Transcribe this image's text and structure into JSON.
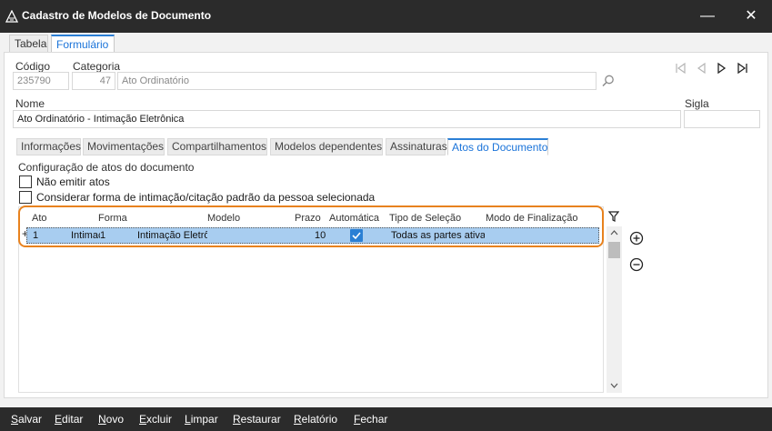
{
  "window": {
    "title": "Cadastro de Modelos de Documento",
    "minimize_glyph": "—",
    "close_glyph": "✕"
  },
  "top_tabs": [
    {
      "label": "Tabela",
      "active": false
    },
    {
      "label": "Formulário",
      "active": true
    }
  ],
  "form": {
    "codigo_label": "Código",
    "codigo_value": "235790",
    "categoria_label": "Categoria",
    "categoria_id": "47",
    "categoria_name": "Ato Ordinatório",
    "nome_label": "Nome",
    "nome_value": "Ato Ordinatório - Intimação Eletrônica",
    "sigla_label": "Sigla",
    "sigla_value": ""
  },
  "sub_tabs": [
    {
      "label": "Informações",
      "active": false
    },
    {
      "label": "Movimentações",
      "active": false
    },
    {
      "label": "Compartilhamentos",
      "active": false
    },
    {
      "label": "Modelos dependentes",
      "active": false
    },
    {
      "label": "Assinaturas",
      "active": false
    },
    {
      "label": "Atos do Documento",
      "active": true
    }
  ],
  "atos": {
    "section_title": "Configuração de atos do documento",
    "opt_nao_emitir": "Não emitir atos",
    "opt_considerar": "Considerar forma de intimação/citação padrão da pessoa selecionada",
    "columns": [
      "Ato",
      "Forma",
      "Modelo",
      "Prazo",
      "Automática",
      "Tipo de Seleção",
      "Modo de Finalização"
    ],
    "rows": [
      {
        "marker": "+",
        "ato": "1",
        "forma": "Intimação",
        "modelo_id": "1",
        "modelo": "Intimação Eletrônica",
        "prazo": "10",
        "automatica": true,
        "tipo_selecao": "Todas as partes ativas",
        "modo_finalizacao": ""
      }
    ]
  },
  "bottom_actions": [
    {
      "label": "Salvar",
      "key": "S",
      "rest": "alvar"
    },
    {
      "label": "Editar",
      "key": "E",
      "rest": "ditar"
    },
    {
      "label": "Novo",
      "key": "N",
      "rest": "ovo"
    },
    {
      "label": "Excluir",
      "key": "E",
      "rest": "xcluir"
    },
    {
      "label": "Limpar",
      "key": "L",
      "rest": "impar"
    },
    {
      "label": "Restaurar",
      "key": "R",
      "rest": "estaurar"
    },
    {
      "label": "Relatório",
      "key": "R",
      "rest": "elatório"
    },
    {
      "label": "Fechar",
      "key": "F",
      "rest": "echar"
    }
  ],
  "colors": {
    "accent": "#2b7fd6",
    "highlight_border": "#e8821e",
    "selected_row": "#a8cdf0",
    "titlebar": "#2b2b2b"
  },
  "icons": {
    "search": "magnifier-icon",
    "first": "first-record-icon",
    "prev": "previous-record-icon",
    "next": "next-record-icon",
    "last": "last-record-icon",
    "filter": "filter-icon",
    "add": "plus-circle-icon",
    "remove": "minus-circle-icon"
  }
}
